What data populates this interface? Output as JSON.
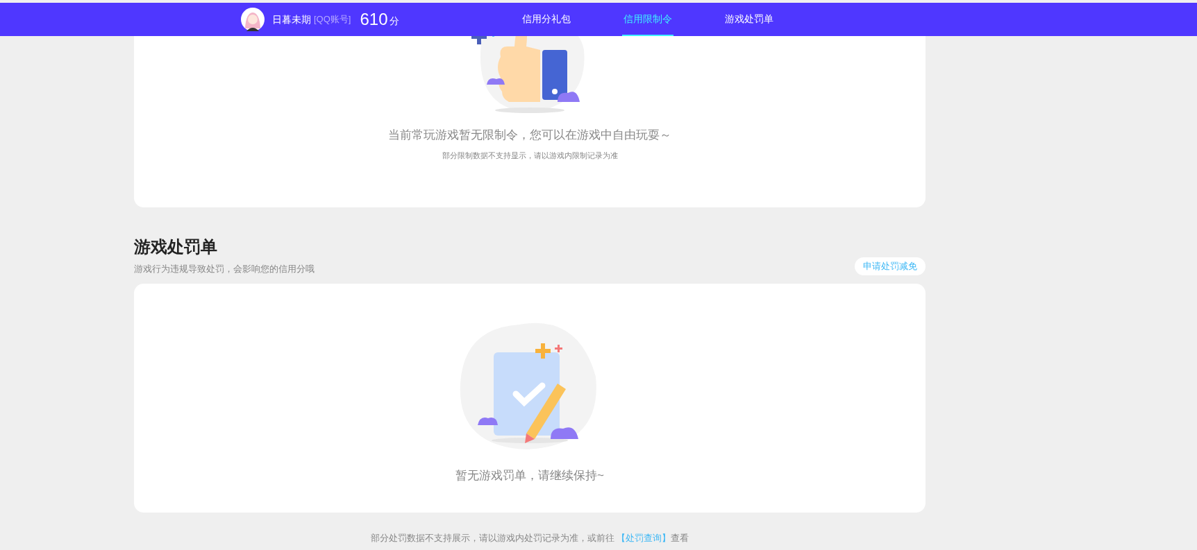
{
  "nav": {
    "user_name": "日暮未期",
    "account_tag": "[QQ账号]",
    "score": "610",
    "score_unit": "分",
    "tabs": [
      {
        "label": "信用分礼包",
        "selected": false
      },
      {
        "label": "信用限制令",
        "selected": true
      },
      {
        "label": "游戏处罚单",
        "selected": false
      }
    ]
  },
  "restriction_card": {
    "message": "当前常玩游戏暂无限制令，您可以在游戏中自由玩耍～",
    "note": "部分限制数据不支持显示，请以游戏内限制记录为准"
  },
  "penalty_section": {
    "title": "游戏处罚单",
    "subtitle": "游戏行为违规导致处罚，会影响您的信用分哦",
    "action_button": "申请处罚减免",
    "empty_message": "暂无游戏罚单，请继续保持~"
  },
  "footer": {
    "text": "部分处罚数据不支持展示，请以游戏内处罚记录为准，或前往",
    "link": "【处罚查询】",
    "suffix": "查看"
  }
}
